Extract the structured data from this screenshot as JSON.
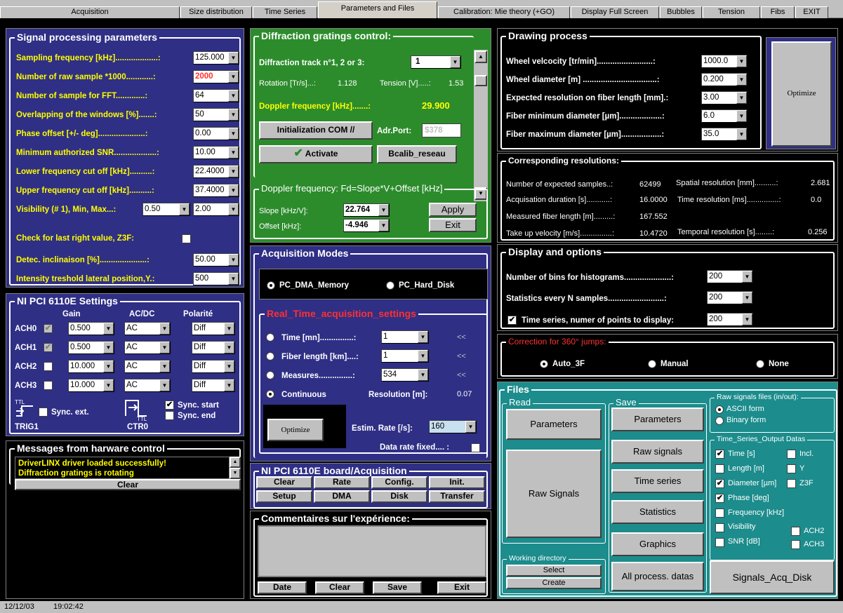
{
  "tabs": [
    "Acquisition",
    "Size distribution",
    "Time Series",
    "Parameters and Files",
    "Calibration: Mie theory (+GO)",
    "Display Full Screen",
    "Bubbles",
    "Tension",
    "Fibs",
    "EXIT"
  ],
  "signal": {
    "title": "Signal processing parameters",
    "sampling_label": "Sampling frequency [kHz]...................:",
    "sampling_val": "125.000",
    "raw_label": "Number of raw sample *1000............:",
    "raw_val": "2000",
    "fft_label": "Number of sample for FFT.............:",
    "fft_val": "64",
    "overlap_label": "Overlapping of the windows [%].......:",
    "overlap_val": "50",
    "phase_label": "Phase offset [+/- deg].....................:",
    "phase_val": "0.00",
    "snr_label": "Minimum authorized SNR...................:",
    "snr_val": "10.00",
    "lower_label": "Lower frequency cut off [kHz]..........:",
    "lower_val": "22.4000",
    "upper_label": "Upper frequency cut off [kHz]..........:",
    "upper_val": "37.4000",
    "vis_label": "Visibility (# 1), Min, Max...:",
    "vis_min": "0.50",
    "vis_max": "2.00",
    "check_label": "Check for last right value, Z3F:",
    "detec_label": "Detec. inclinaison  [%].....................:",
    "detec_val": "50.00",
    "intensity_label": "Intensity treshold lateral position,Y.:",
    "intensity_val": "500"
  },
  "ni": {
    "title": "NI PCI 6110E Settings",
    "h_gain": "Gain",
    "h_acdc": "AC/DC",
    "h_pol": "Polarité",
    "rows": [
      {
        "ch": "ACH0",
        "gain": "0.500",
        "acdc": "AC",
        "pol": "Diff"
      },
      {
        "ch": "ACH1",
        "gain": "0.500",
        "acdc": "AC",
        "pol": "Diff"
      },
      {
        "ch": "ACH2",
        "gain": "10.000",
        "acdc": "AC",
        "pol": "Diff"
      },
      {
        "ch": "ACH3",
        "gain": "10.000",
        "acdc": "AC",
        "pol": "Diff"
      }
    ],
    "ttl": "TTL",
    "sync_ext": "Sync. ext.",
    "trig": "TRIG1",
    "sync_start": "Sync. start",
    "sync_end": "Sync. end",
    "ctr": "CTR0"
  },
  "messages": {
    "title": "Messages from harware control",
    "line1": "DriverLINX driver loaded successfully!",
    "line2": "Diffraction gratings is rotating",
    "clear": "Clear"
  },
  "diff": {
    "title": "Diffraction gratings control:",
    "track_label": "Diffraction track n°1, 2 or 3:",
    "track_val": "1",
    "rot_label": "Rotation [Tr/s]...:",
    "rot_val": "1.128",
    "tension_label": "Tension [V].....:",
    "tension_val": "1.53",
    "doppler_label": "Doppler frequency [kHz].......:",
    "doppler_val": "29.900",
    "init_btn": "Initialization COM //",
    "adr_label": "Adr.Port:",
    "adr_val": "$378",
    "activate_btn": "Activate",
    "bcalib_btn": "Bcalib_reseau",
    "formula": "Doppler frequency:  Fd=Slope*V+Offset [kHz]",
    "slope_label": "Slope [kHz/V]:",
    "slope_val": "22.764",
    "offset_label": "Offset [kHz]:",
    "offset_val": "-4.946",
    "apply_btn": "Apply",
    "exit_btn": "Exit"
  },
  "acq": {
    "title": "Acquisition Modes",
    "mode1": "PC_DMA_Memory",
    "mode2": "PC_Hard_Disk",
    "rt_title": "Real_Time_acquisition_settings",
    "time_label": "Time [mn]...............:",
    "time_val": "1",
    "fiber_label": "Fiber length [km]....:",
    "fiber_val": "1",
    "meas_label": "Measures...............:",
    "meas_val": "534",
    "arrow": "<<",
    "cont_label": "Continuous",
    "res_label": "Resolution [m]:",
    "res_val": "0.07",
    "optimize_btn": "Optimize",
    "rate_label": "Estim. Rate [/s]:",
    "rate_val": "160",
    "fixed_label": "Data rate fixed.... :"
  },
  "board": {
    "title": "NI PCI 6110E board/Acquisition",
    "b1": "Clear",
    "b2": "Rate",
    "b3": "Config.",
    "b4": "Init.",
    "b5": "Setup",
    "b6": "DMA",
    "b7": "Disk",
    "b8": "Transfer"
  },
  "comment": {
    "title": "Commentaires sur l'expérience:",
    "b1": "Date",
    "b2": "Clear",
    "b3": "Save",
    "b4": "Exit"
  },
  "draw": {
    "title": "Drawing process",
    "wv_label": "Wheel velcocity [tr/min].........................:",
    "wv_val": "1000.0",
    "wd_label": "Wheel diameter [m] .................................:",
    "wd_val": "0.200",
    "er_label": "Expected resolution on fiber length [mm].:",
    "er_val": "3.00",
    "fmin_label": "Fiber  minimum diameter [µm]...................:",
    "fmin_val": "6.0",
    "fmax_label": "Fiber maximum diameter [µm]..................:",
    "fmax_val": "35.0",
    "optimize_btn": "Optimize"
  },
  "corr": {
    "title": "Corresponding resolutions:",
    "n_label": "Number of expected samples..:",
    "n_val": "62499",
    "sr_label": "Spatial resolution [mm]..........:",
    "sr_val": "2.681",
    "ad_label": "Acquisation duration [s]...........:",
    "ad_val": "16.0000",
    "tr_label": "Time resolution [ms]...............:",
    "tr_val": "0.0",
    "ml_label": "Measured fiber length [m].........:",
    "ml_val": "167.552",
    "tv_label": "Take up velocity [m/s]...............:",
    "tv_val": "10.4720",
    "temp_label": "Temporal resolution [s]........:",
    "temp_val": "0.256"
  },
  "disp": {
    "title": "Display and options",
    "bins_label": "Number of bins for histograms.....................:",
    "bins_val": "200",
    "stat_label": "Statistics every N samples.........................:",
    "stat_val": "200",
    "ts_label": "Time series, numer of points to display:",
    "ts_val": "200"
  },
  "jumps": {
    "title": "Correction for 360° jumps:",
    "o1": "Auto_3F",
    "o2": "Manual",
    "o3": "None"
  },
  "files": {
    "title": "Files",
    "read": "Read",
    "save": "Save",
    "r_params": "Parameters",
    "r_raw": "Raw Signals",
    "s_params": "Parameters",
    "s_raw": "Raw signals",
    "s_ts": "Time series",
    "s_stat": "Statistics",
    "s_graph": "Graphics",
    "s_all": "All process. datas",
    "raw_title": "Raw signals files (in/out):",
    "ascii": "ASCII form",
    "binary": "Binary form",
    "ts_title": "Time_Series_Output Datas",
    "c_time": "Time [s]",
    "c_incl": "Incl.",
    "c_length": "Length [m]",
    "c_y": "Y",
    "c_diam": "Diameter [µm]",
    "c_z3f": "Z3F",
    "c_phase": "Phase [deg]",
    "c_freq": "Frequency [kHz]",
    "c_vis": "Visibility",
    "c_ach2": "ACH2",
    "c_snr": "SNR [dB]",
    "c_ach3": "ACH3",
    "wd_title": "Working directory",
    "select": "Select",
    "create": "Create",
    "sig_btn": "Signals_Acq_Disk"
  },
  "status": {
    "date": "12/12/03",
    "time": "19:02:42"
  }
}
